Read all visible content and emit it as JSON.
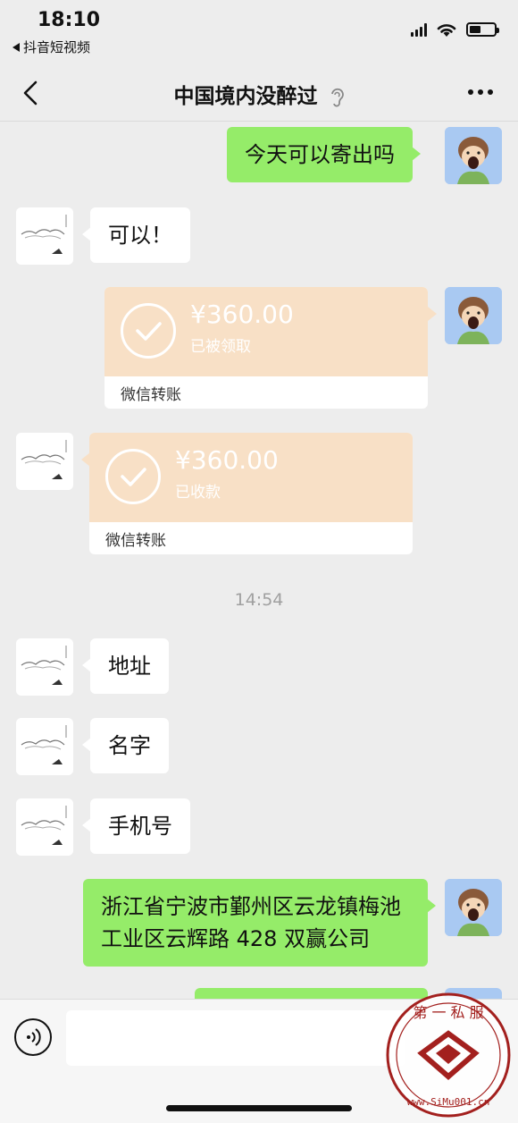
{
  "status_bar": {
    "time": "18:10",
    "back_app": "抖音短视频"
  },
  "nav": {
    "title": "中国境内没醉过"
  },
  "messages": {
    "m1": "今天可以寄出吗",
    "m2": "可以！",
    "transfer1": {
      "amount": "¥360.00",
      "status": "已被领取",
      "label": "微信转账"
    },
    "transfer2": {
      "amount": "¥360.00",
      "status": "已收款",
      "label": "微信转账"
    },
    "time_divider": "14:54",
    "m3": "地址",
    "m4": "名字",
    "m5": "手机号",
    "m6": "浙江省宁波市鄞州区云龙镇梅池工业区云辉路 428 双赢公司"
  },
  "input": {
    "placeholder": ""
  },
  "watermark": {
    "text": "第一私服",
    "url": "www.SiMu001.cn"
  },
  "icons": [
    "back-arrow-icon",
    "ear-icon",
    "more-icon",
    "signal-icon",
    "wifi-icon",
    "battery-icon",
    "check-icon",
    "voice-icon",
    "avatar-me",
    "avatar-other"
  ],
  "colors": {
    "bg": "#ededed",
    "green_bubble": "#95ec69",
    "transfer_bg": "#f8e0c6",
    "accent": "#111111"
  }
}
